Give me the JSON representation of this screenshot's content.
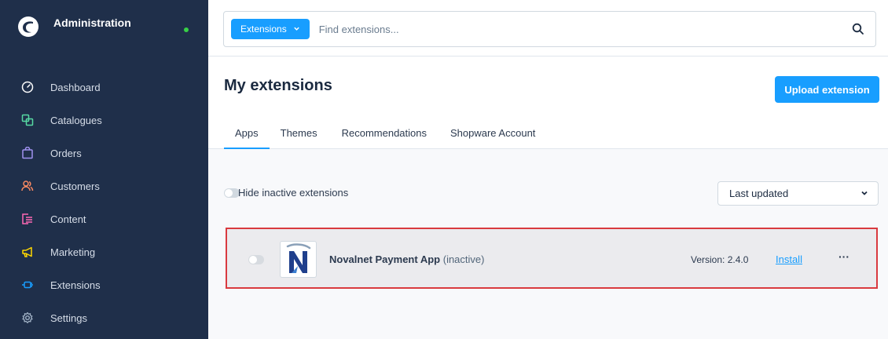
{
  "sidebar": {
    "title": "Administration",
    "items": [
      {
        "label": "Dashboard",
        "icon": "dashboard-icon",
        "color": "#ffffff"
      },
      {
        "label": "Catalogues",
        "icon": "catalogue-icon",
        "color": "#57d9a3"
      },
      {
        "label": "Orders",
        "icon": "orders-bag-icon",
        "color": "#a092f0"
      },
      {
        "label": "Customers",
        "icon": "customers-icon",
        "color": "#f88962"
      },
      {
        "label": "Content",
        "icon": "content-icon",
        "color": "#ff68b4"
      },
      {
        "label": "Marketing",
        "icon": "megaphone-icon",
        "color": "#ffd700"
      },
      {
        "label": "Extensions",
        "icon": "plug-icon",
        "color": "#189eff"
      },
      {
        "label": "Settings",
        "icon": "gear-icon",
        "color": "#a2b3c7"
      }
    ]
  },
  "search": {
    "scope_label": "Extensions",
    "placeholder": "Find extensions..."
  },
  "header": {
    "title": "My extensions",
    "upload_label": "Upload extension",
    "tabs": [
      "Apps",
      "Themes",
      "Recommendations",
      "Shopware Account"
    ]
  },
  "filters": {
    "hide_inactive_label": "Hide inactive extensions",
    "sort_value": "Last updated"
  },
  "extension": {
    "name": "Novalnet Payment App",
    "status": "(inactive)",
    "version": "Version: 2.4.0",
    "action": "Install",
    "more": "···"
  },
  "colors": {
    "accent": "#189eff",
    "sidebar_bg": "#1f2f4a",
    "highlight_border": "#d93a3f",
    "online_dot": "#37d046"
  }
}
